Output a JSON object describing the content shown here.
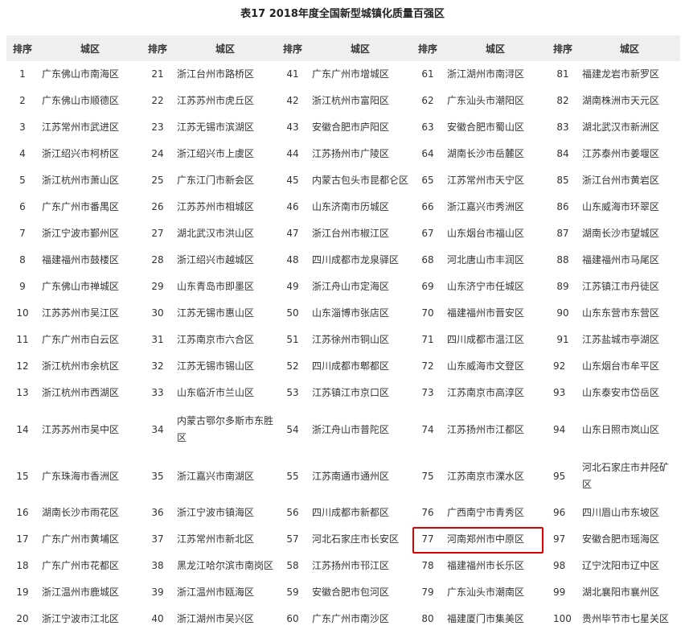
{
  "title": "表17 2018年度全国新型城镇化质量百强区",
  "headers": [
    "排序",
    "城区",
    "排序",
    "城区",
    "排序",
    "城区",
    "排序",
    "城区",
    "排序",
    "城区"
  ],
  "rows": [
    [
      [
        "1",
        "广东佛山市南海区"
      ],
      [
        "21",
        "浙江台州市路桥区"
      ],
      [
        "41",
        "广东广州市增城区"
      ],
      [
        "61",
        "浙江湖州市南浔区"
      ],
      [
        "81",
        "福建龙岩市新罗区"
      ]
    ],
    [
      [
        "2",
        "广东佛山市顺德区"
      ],
      [
        "22",
        "江苏苏州市虎丘区"
      ],
      [
        "42",
        "浙江杭州市富阳区"
      ],
      [
        "62",
        "广东汕头市潮阳区"
      ],
      [
        "82",
        "湖南株洲市天元区"
      ]
    ],
    [
      [
        "3",
        "江苏常州市武进区"
      ],
      [
        "23",
        "江苏无锡市滨湖区"
      ],
      [
        "43",
        "安徽合肥市庐阳区"
      ],
      [
        "63",
        "安徽合肥市蜀山区"
      ],
      [
        "83",
        "湖北武汉市新洲区"
      ]
    ],
    [
      [
        "4",
        "浙江绍兴市柯桥区"
      ],
      [
        "24",
        "浙江绍兴市上虞区"
      ],
      [
        "44",
        "江苏扬州市广陵区"
      ],
      [
        "64",
        "湖南长沙市岳麓区"
      ],
      [
        "84",
        "江苏泰州市姜堰区"
      ]
    ],
    [
      [
        "5",
        "浙江杭州市萧山区"
      ],
      [
        "25",
        "广东江门市新会区"
      ],
      [
        "45",
        "内蒙古包头市昆都仑区"
      ],
      [
        "65",
        "江苏常州市天宁区"
      ],
      [
        "85",
        "浙江台州市黄岩区"
      ]
    ],
    [
      [
        "6",
        "广东广州市番禺区"
      ],
      [
        "26",
        "江苏苏州市相城区"
      ],
      [
        "46",
        "山东济南市历城区"
      ],
      [
        "66",
        "浙江嘉兴市秀洲区"
      ],
      [
        "86",
        "山东威海市环翠区"
      ]
    ],
    [
      [
        "7",
        "浙江宁波市鄞州区"
      ],
      [
        "27",
        "湖北武汉市洪山区"
      ],
      [
        "47",
        "浙江台州市椒江区"
      ],
      [
        "67",
        "山东烟台市福山区"
      ],
      [
        "87",
        "湖南长沙市望城区"
      ]
    ],
    [
      [
        "8",
        "福建福州市鼓楼区"
      ],
      [
        "28",
        "浙江绍兴市越城区"
      ],
      [
        "48",
        "四川成都市龙泉驿区"
      ],
      [
        "68",
        "河北唐山市丰润区"
      ],
      [
        "88",
        "福建福州市马尾区"
      ]
    ],
    [
      [
        "9",
        "广东佛山市禅城区"
      ],
      [
        "29",
        "山东青岛市即墨区"
      ],
      [
        "49",
        "浙江舟山市定海区"
      ],
      [
        "69",
        "山东济宁市任城区"
      ],
      [
        "89",
        "江苏镇江市丹徒区"
      ]
    ],
    [
      [
        "10",
        "江苏苏州市吴江区"
      ],
      [
        "30",
        "江苏无锡市惠山区"
      ],
      [
        "50",
        "山东淄博市张店区"
      ],
      [
        "70",
        "福建福州市晋安区"
      ],
      [
        "90",
        "山东东营市东营区"
      ]
    ],
    [
      [
        "11",
        "广东广州市白云区"
      ],
      [
        "31",
        "江苏南京市六合区"
      ],
      [
        "51",
        "江苏徐州市铜山区"
      ],
      [
        "71",
        "四川成都市温江区"
      ],
      [
        "91",
        "江苏盐城市亭湖区"
      ]
    ],
    [
      [
        "12",
        "浙江杭州市余杭区"
      ],
      [
        "32",
        "江苏无锡市锡山区"
      ],
      [
        "52",
        "四川成都市郫都区"
      ],
      [
        "72",
        "山东威海市文登区"
      ],
      [
        "92",
        "山东烟台市牟平区"
      ]
    ],
    [
      [
        "13",
        "浙江杭州市西湖区"
      ],
      [
        "33",
        "山东临沂市兰山区"
      ],
      [
        "53",
        "江苏镇江市京口区"
      ],
      [
        "73",
        "江苏南京市高淳区"
      ],
      [
        "93",
        "山东泰安市岱岳区"
      ]
    ],
    [
      [
        "14",
        "江苏苏州市吴中区"
      ],
      [
        "34",
        "内蒙古鄂尔多斯市东胜区"
      ],
      [
        "54",
        "浙江舟山市普陀区"
      ],
      [
        "74",
        "江苏扬州市江都区"
      ],
      [
        "94",
        "山东日照市岚山区"
      ]
    ],
    [
      [
        "15",
        "广东珠海市香洲区"
      ],
      [
        "35",
        "浙江嘉兴市南湖区"
      ],
      [
        "55",
        "江苏南通市通州区"
      ],
      [
        "75",
        "江苏南京市溧水区"
      ],
      [
        "95",
        "河北石家庄市井陉矿区"
      ]
    ],
    [
      [
        "16",
        "湖南长沙市雨花区"
      ],
      [
        "36",
        "浙江宁波市镇海区"
      ],
      [
        "56",
        "四川成都市新都区"
      ],
      [
        "76",
        "广西南宁市青秀区"
      ],
      [
        "96",
        "四川眉山市东坡区"
      ]
    ],
    [
      [
        "17",
        "广东广州市黄埔区"
      ],
      [
        "37",
        "江苏常州市新北区"
      ],
      [
        "57",
        "河北石家庄市长安区"
      ],
      [
        "77",
        "河南郑州市中原区"
      ],
      [
        "97",
        "安徽合肥市瑶海区"
      ]
    ],
    [
      [
        "18",
        "广东广州市花都区"
      ],
      [
        "38",
        "黑龙江哈尔滨市南岗区"
      ],
      [
        "58",
        "江苏扬州市邗江区"
      ],
      [
        "78",
        "福建福州市长乐区"
      ],
      [
        "98",
        "辽宁沈阳市辽中区"
      ]
    ],
    [
      [
        "19",
        "浙江温州市鹿城区"
      ],
      [
        "39",
        "浙江温州市瓯海区"
      ],
      [
        "59",
        "安徽合肥市包河区"
      ],
      [
        "79",
        "广东汕头市潮南区"
      ],
      [
        "99",
        "湖北襄阳市襄州区"
      ]
    ],
    [
      [
        "20",
        "浙江宁波市江北区"
      ],
      [
        "40",
        "浙江湖州市吴兴区"
      ],
      [
        "60",
        "广东广州市南沙区"
      ],
      [
        "80",
        "福建厦门市集美区"
      ],
      [
        "100",
        "贵州毕节市七星关区"
      ]
    ]
  ],
  "tall_rows": [
    13,
    14
  ],
  "highlight": {
    "row": 16,
    "group": 3,
    "color": "#e00000"
  },
  "left_aligned_ranks": [
    "92",
    "93",
    "94",
    "95",
    "96",
    "97",
    "98",
    "99",
    "100"
  ]
}
